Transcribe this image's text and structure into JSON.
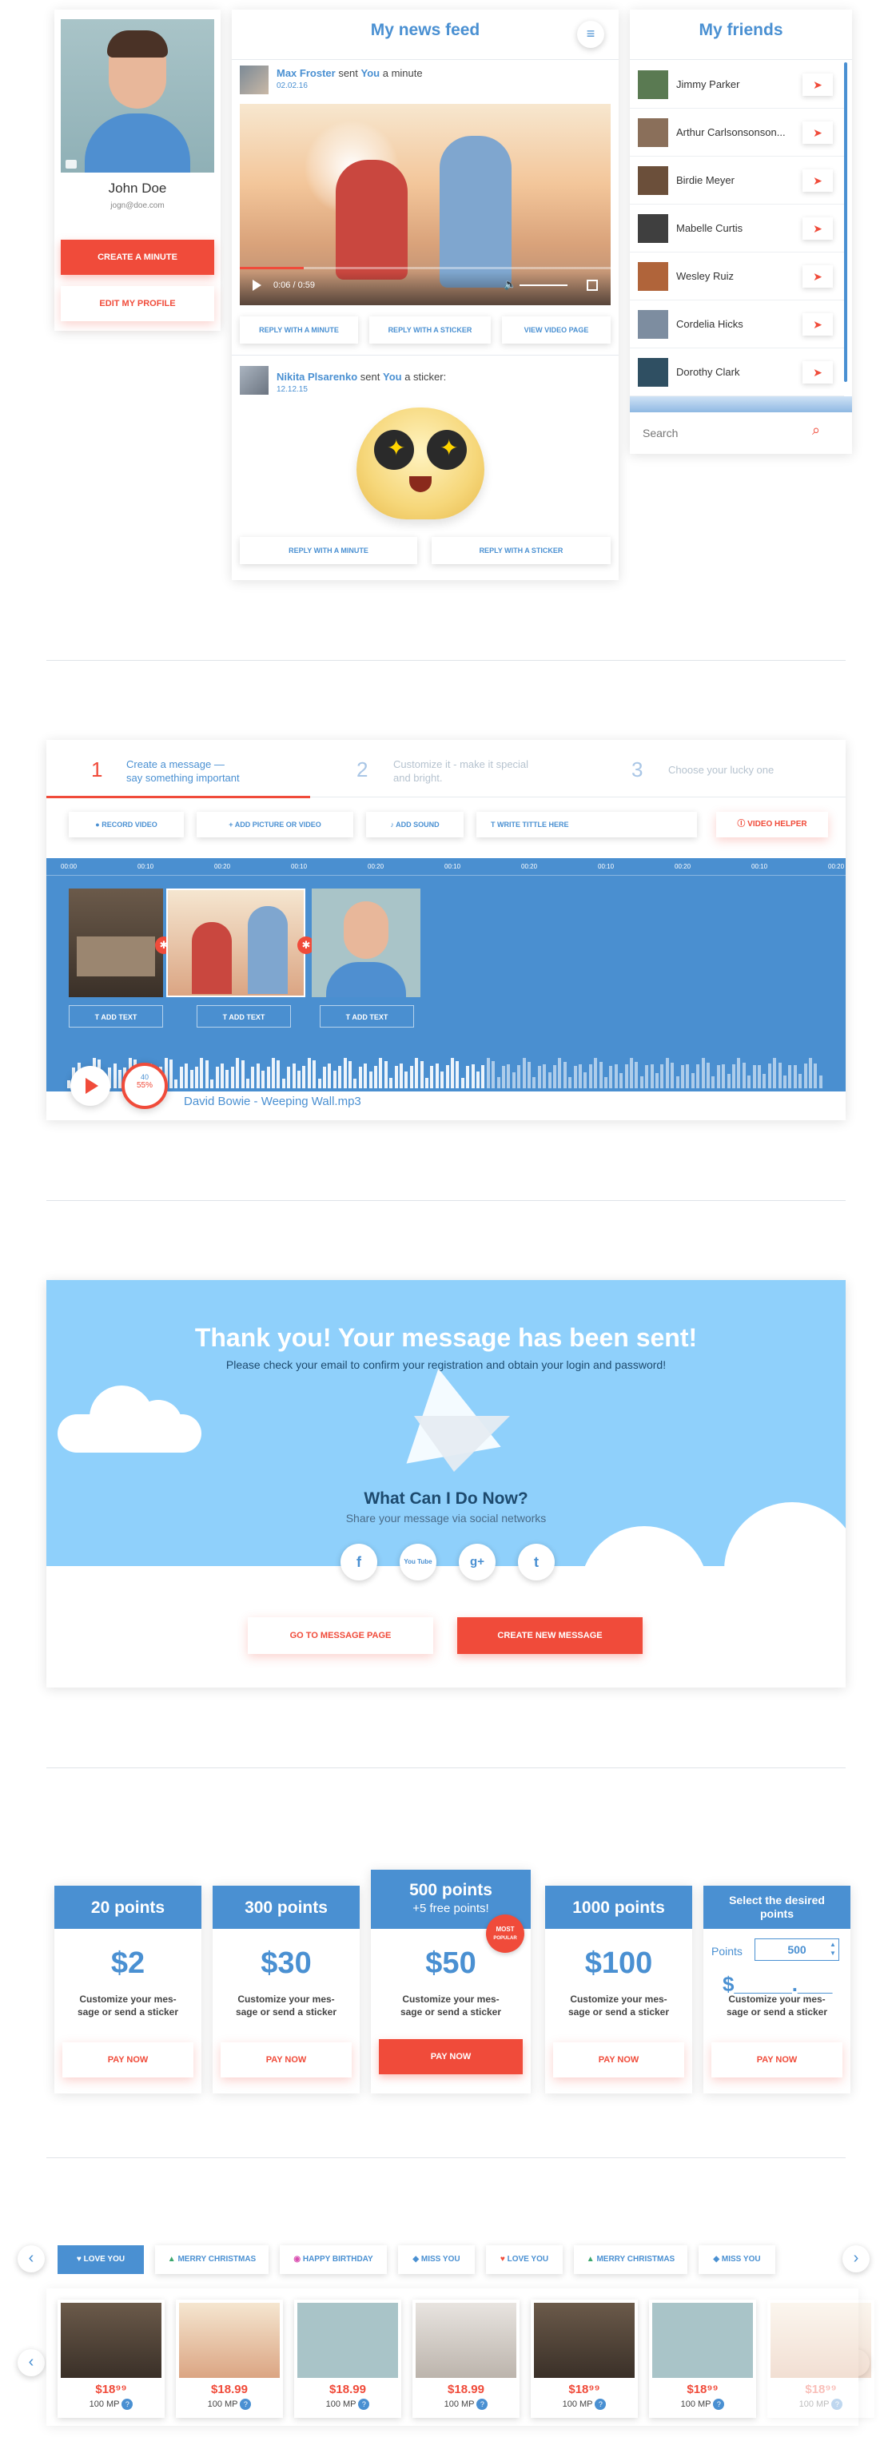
{
  "profile": {
    "name": "John Doe",
    "email": "jogn@doe.com",
    "create_label": "CREATE A MINUTE",
    "edit_label": "EDIT MY PROFILE"
  },
  "news_feed": {
    "title": "My news feed",
    "posts": [
      {
        "author": "Max Froster",
        "sent": "sent",
        "you": "You",
        "what": "a minute",
        "date": "02.02.16",
        "time": "0:06 / 0:59",
        "actions": [
          "REPLY WITH A MINUTE",
          "REPLY WITH A STICKER",
          "VIEW VIDEO PAGE"
        ]
      },
      {
        "author": "Nikita Plsarenko",
        "sent": "sent",
        "you": "You",
        "what": "a sticker:",
        "date": "12.12.15",
        "actions": [
          "REPLY WITH A MINUTE",
          "REPLY WITH A STICKER"
        ]
      }
    ]
  },
  "friends": {
    "title": "My friends",
    "list": [
      "Jimmy Parker",
      "Arthur Carlsonsonson...",
      "Birdie Meyer",
      "Mabelle Curtis",
      "Wesley Ruiz",
      "Cordelia Hicks",
      "Dorothy Clark"
    ],
    "search_placeholder": "Search"
  },
  "editor": {
    "steps": [
      {
        "num": "1",
        "text": "Create a message —\nsay something important"
      },
      {
        "num": "2",
        "text": "Customize it - make it special\nand bright."
      },
      {
        "num": "3",
        "text": "Choose your lucky one"
      }
    ],
    "tools": [
      "RECORD VIDEO",
      "ADD PICTURE OR VIDEO",
      "ADD SOUND",
      "WRITE TITTLE HERE"
    ],
    "helper_label": "VIDEO HELPER",
    "timeline_ticks": [
      "00:00",
      "00:10",
      "00:20",
      "00:10",
      "00:20",
      "00:10",
      "00:20",
      "00:10",
      "00:20",
      "00:10",
      "00:20"
    ],
    "add_text_label": "ADD TEXT",
    "timer_top": "40",
    "timer_bottom": "55%",
    "track": "David Bowie - Weeping Wall.mp3",
    "progress": 0.55
  },
  "thankyou": {
    "title": "Thank you! Your message has been sent!",
    "subtitle": "Please check your email to confirm your registration and obtain your login and password!",
    "what_title": "What Can I Do Now?",
    "what_sub": "Share your message via social networks",
    "social": [
      "f",
      "You Tube",
      "g+",
      "t"
    ],
    "go_label": "GO TO MESSAGE PAGE",
    "new_label": "CREATE NEW MESSAGE"
  },
  "pricing": {
    "plans": [
      {
        "title": "20 points",
        "price": "$2",
        "desc": "Customize your mes-\nsage or send a sticker",
        "cta": "PAY NOW"
      },
      {
        "title": "300 points",
        "price": "$30",
        "desc": "Customize your mes-\nsage or send a sticker",
        "cta": "PAY NOW"
      },
      {
        "title": "500 points",
        "extra": "+5 free points!",
        "price": "$50",
        "desc": "Customize your mes-\nsage or send a sticker",
        "cta": "PAY NOW",
        "badge_top": "MOST",
        "badge_bottom": "POPULAR"
      },
      {
        "title": "1000 points",
        "price": "$100",
        "desc": "Customize your mes-\nsage or send a sticker",
        "cta": "PAY NOW"
      },
      {
        "title": "Select the desired points",
        "points_label": "Points",
        "points_value": "500",
        "price": "$_____.___",
        "desc": "Customize your mes-\nsage or send a sticker",
        "cta": "PAY NOW"
      }
    ]
  },
  "shop": {
    "categories": [
      "LOVE YOU",
      "MERRY CHRISTMAS",
      "HAPPY BIRTHDAY",
      "MISS YOU",
      "LOVE YOU",
      "MERRY CHRISTMAS",
      "MISS YOU"
    ],
    "items": [
      {
        "price": "$18⁹⁹",
        "mp": "100 MP"
      },
      {
        "price": "$18.99",
        "mp": "100 MP"
      },
      {
        "price": "$18.99",
        "mp": "100 MP"
      },
      {
        "price": "$18.99",
        "mp": "100 MP"
      },
      {
        "price": "$18⁹⁹",
        "mp": "100 MP"
      },
      {
        "price": "$18⁹⁹",
        "mp": "100 MP"
      },
      {
        "price": "$18⁹⁹",
        "mp": "100 MP"
      }
    ],
    "mp_icon": "?"
  },
  "colors": {
    "accent_red": "#f04b3a",
    "accent_blue": "#4a90d2",
    "sky": "#8fd0fb",
    "timeline": "#4a8fd0"
  }
}
